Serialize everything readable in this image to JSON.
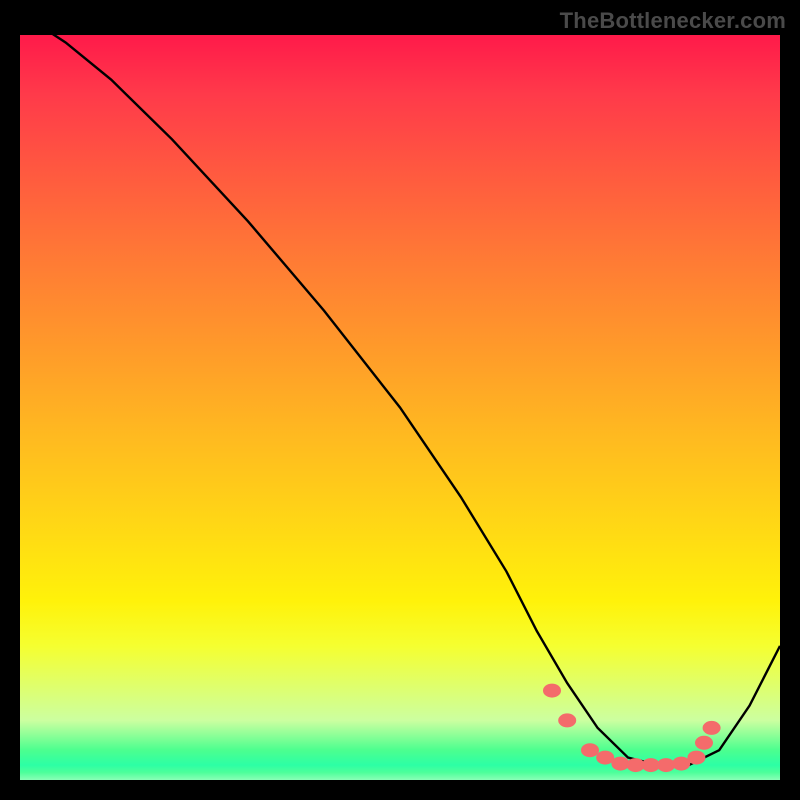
{
  "watermark": "TheBottlenecker.com",
  "chart_data": {
    "type": "line",
    "title": "",
    "xlabel": "",
    "ylabel": "",
    "xlim": [
      0,
      100
    ],
    "ylim": [
      0,
      100
    ],
    "series": [
      {
        "name": "curve",
        "x": [
          0,
          6,
          12,
          20,
          30,
          40,
          50,
          58,
          64,
          68,
          72,
          76,
          80,
          84,
          88,
          92,
          96,
          100
        ],
        "y": [
          103,
          99,
          94,
          86,
          75,
          63,
          50,
          38,
          28,
          20,
          13,
          7,
          3,
          2,
          2,
          4,
          10,
          18
        ]
      }
    ],
    "markers": {
      "name": "highlight-points",
      "x": [
        70,
        72,
        75,
        77,
        79,
        81,
        83,
        85,
        87,
        89,
        90,
        91
      ],
      "y": [
        12,
        8,
        4,
        3,
        2.2,
        2,
        2,
        2,
        2.2,
        3,
        5,
        7
      ]
    },
    "gradient_stops": [
      {
        "pos": 0,
        "color": "#ff1a4a"
      },
      {
        "pos": 50,
        "color": "#ffba20"
      },
      {
        "pos": 80,
        "color": "#fff20a"
      },
      {
        "pos": 100,
        "color": "#4eff9a"
      }
    ]
  }
}
